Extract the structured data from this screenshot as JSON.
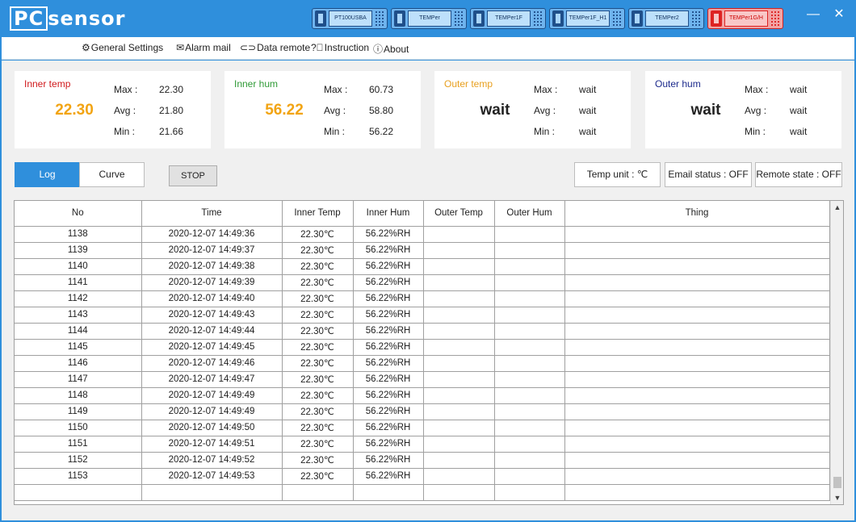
{
  "app": {
    "logo_pc": "PC",
    "logo_sensor": "sensor",
    "devices": [
      "PT100USBA",
      "TEMPer",
      "TEMPer1F",
      "TEMPer1F_H1",
      "TEMPer2",
      "TEMPer1G/H"
    ],
    "minimize_glyph": "—",
    "close_glyph": "✕"
  },
  "menu": {
    "general_settings": "General Settings",
    "alarm_mail": "Alarm mail",
    "data_remote": "Data remote",
    "instruction": "Instruction",
    "about": "About"
  },
  "cards": {
    "inner_temp": {
      "name": "Inner temp",
      "value": "22.30",
      "max_label": "Max :",
      "max": "22.30",
      "avg_label": "Avg :",
      "avg": "21.80",
      "min_label": "Min :",
      "min": "21.66"
    },
    "inner_hum": {
      "name": "Inner hum",
      "value": "56.22",
      "max_label": "Max :",
      "max": "60.73",
      "avg_label": "Avg :",
      "avg": "58.80",
      "min_label": "Min :",
      "min": "56.22"
    },
    "outer_temp": {
      "name": "Outer temp",
      "value": "wait",
      "max_label": "Max :",
      "max": "wait",
      "avg_label": "Avg :",
      "avg": "wait",
      "min_label": "Min :",
      "min": "wait"
    },
    "outer_hum": {
      "name": "Outer hum",
      "value": "wait",
      "max_label": "Max :",
      "max": "wait",
      "avg_label": "Avg :",
      "avg": "wait",
      "min_label": "Min :",
      "min": "wait"
    }
  },
  "colors": {
    "inner_temp_name": "#d0191c",
    "inner_temp_value": "#f2a413",
    "inner_hum_name": "#2f9a36",
    "inner_hum_value": "#f2a413",
    "outer_temp_name": "#e8a020",
    "outer_hum_name": "#1c2a8c",
    "accent": "#2f8fdc"
  },
  "controls": {
    "tab_log": "Log",
    "tab_curve": "Curve",
    "stop": "STOP",
    "temp_unit": "Temp unit : ℃",
    "email_status": "Email status : OFF",
    "remote_state": "Remote state : OFF"
  },
  "table": {
    "headers": [
      "No",
      "Time",
      "Inner Temp",
      "Inner Hum",
      "Outer Temp",
      "Outer Hum",
      "Thing"
    ],
    "rows": [
      [
        "1138",
        "2020-12-07 14:49:36",
        "22.30℃",
        "56.22%RH",
        "",
        "",
        ""
      ],
      [
        "1139",
        "2020-12-07 14:49:37",
        "22.30℃",
        "56.22%RH",
        "",
        "",
        ""
      ],
      [
        "1140",
        "2020-12-07 14:49:38",
        "22.30℃",
        "56.22%RH",
        "",
        "",
        ""
      ],
      [
        "1141",
        "2020-12-07 14:49:39",
        "22.30℃",
        "56.22%RH",
        "",
        "",
        ""
      ],
      [
        "1142",
        "2020-12-07 14:49:40",
        "22.30℃",
        "56.22%RH",
        "",
        "",
        ""
      ],
      [
        "1143",
        "2020-12-07 14:49:43",
        "22.30℃",
        "56.22%RH",
        "",
        "",
        ""
      ],
      [
        "1144",
        "2020-12-07 14:49:44",
        "22.30℃",
        "56.22%RH",
        "",
        "",
        ""
      ],
      [
        "1145",
        "2020-12-07 14:49:45",
        "22.30℃",
        "56.22%RH",
        "",
        "",
        ""
      ],
      [
        "1146",
        "2020-12-07 14:49:46",
        "22.30℃",
        "56.22%RH",
        "",
        "",
        ""
      ],
      [
        "1147",
        "2020-12-07 14:49:47",
        "22.30℃",
        "56.22%RH",
        "",
        "",
        ""
      ],
      [
        "1148",
        "2020-12-07 14:49:49",
        "22.30℃",
        "56.22%RH",
        "",
        "",
        ""
      ],
      [
        "1149",
        "2020-12-07 14:49:49",
        "22.30℃",
        "56.22%RH",
        "",
        "",
        ""
      ],
      [
        "1150",
        "2020-12-07 14:49:50",
        "22.30℃",
        "56.22%RH",
        "",
        "",
        ""
      ],
      [
        "1151",
        "2020-12-07 14:49:51",
        "22.30℃",
        "56.22%RH",
        "",
        "",
        ""
      ],
      [
        "1152",
        "2020-12-07 14:49:52",
        "22.30℃",
        "56.22%RH",
        "",
        "",
        ""
      ],
      [
        "1153",
        "2020-12-07 14:49:53",
        "22.30℃",
        "56.22%RH",
        "",
        "",
        ""
      ],
      [
        "",
        "",
        "",
        "",
        "",
        "",
        ""
      ]
    ]
  }
}
